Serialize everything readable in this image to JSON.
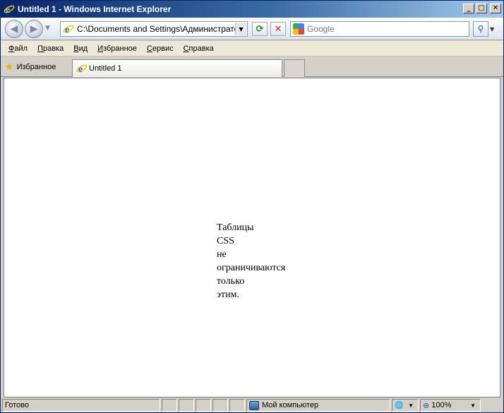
{
  "window": {
    "title": "Untitled 1 - Windows Internet Explorer",
    "controls": {
      "minimize": "_",
      "maximize": "□",
      "close": "✕"
    }
  },
  "address_bar": {
    "url": "C:\\Documents and Settings\\Администратор\\М"
  },
  "search": {
    "placeholder": "Google"
  },
  "menu": {
    "items": [
      {
        "label_ul": "Ф",
        "label_rest": "айл"
      },
      {
        "label_ul": "П",
        "label_rest": "равка"
      },
      {
        "label_ul": "В",
        "label_rest": "ид"
      },
      {
        "label_ul": "И",
        "label_rest": "збранное"
      },
      {
        "label_ul": "С",
        "label_rest": "ервис"
      },
      {
        "label_ul": "С",
        "label_rest": "правка"
      }
    ]
  },
  "favorites": {
    "label": "Избранное"
  },
  "tabs": [
    {
      "label": "Untitled 1"
    }
  ],
  "page": {
    "lines": [
      "Таблицы",
      "CSS",
      "не",
      "ограничиваются",
      "только",
      "этим."
    ]
  },
  "status": {
    "text": "Готово",
    "zone": "Мой компьютер",
    "zoom": "100%"
  },
  "icons": {
    "back": "back-arrow-icon",
    "forward": "forward-arrow-icon",
    "refresh": "refresh-icon",
    "stop": "stop-icon",
    "search_go": "magnifier-icon",
    "favorites": "star-icon"
  }
}
